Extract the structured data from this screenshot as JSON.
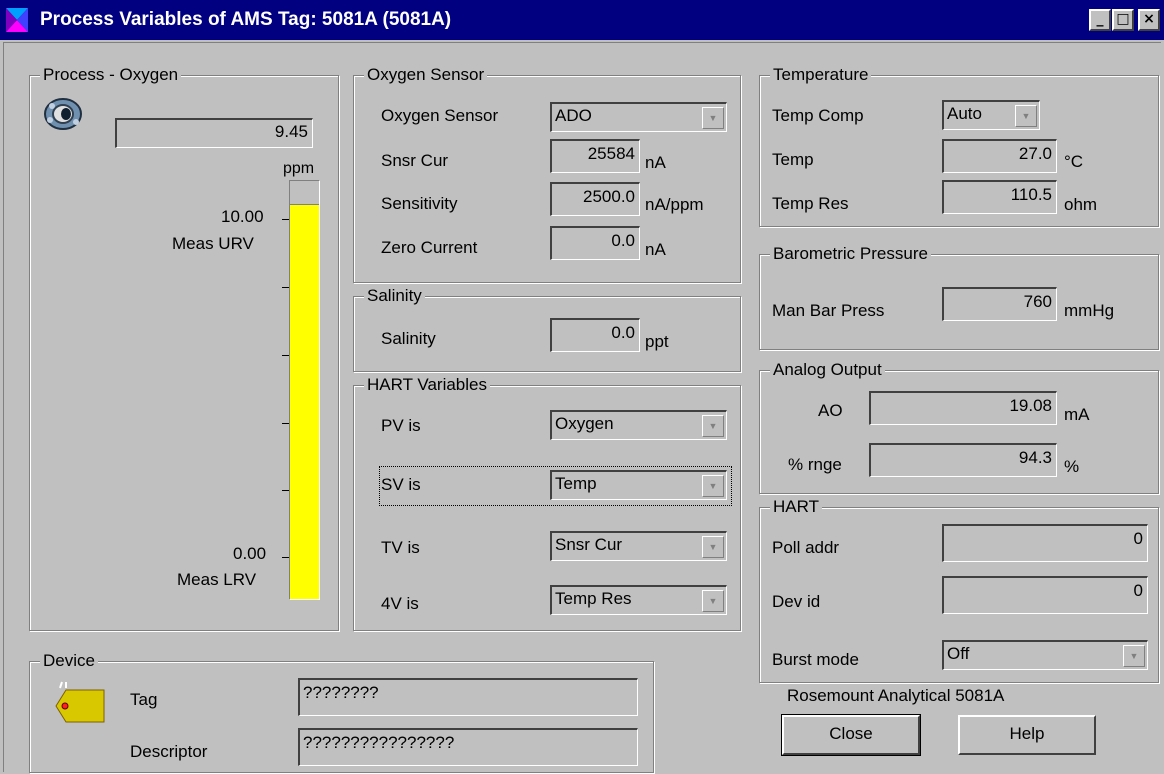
{
  "window": {
    "title": "Process Variables of AMS Tag: 5081A (5081A)",
    "controls": {
      "minimize": "_",
      "maximize": "□",
      "close": "×"
    },
    "colors": {
      "titlebar": "#000080",
      "face": "#c0c0c0",
      "gauge_fill": "#ffff00"
    }
  },
  "process": {
    "legend": "Process - Oxygen",
    "value": "9.45",
    "unit": "ppm",
    "urv_value": "10.00",
    "urv_label": "Meas URV",
    "lrv_value": "0.00",
    "lrv_label": "Meas LRV",
    "fill_fraction": 0.945
  },
  "oxygen_sensor": {
    "legend": "Oxygen Sensor",
    "sensor_label": "Oxygen Sensor",
    "sensor_value": "ADO",
    "snsr_cur_label": "Snsr Cur",
    "snsr_cur_value": "25584",
    "snsr_cur_unit": "nA",
    "sensitivity_label": "Sensitivity",
    "sensitivity_value": "2500.0",
    "sensitivity_unit": "nA/ppm",
    "zero_current_label": "Zero Current",
    "zero_current_value": "0.0",
    "zero_current_unit": "nA"
  },
  "salinity": {
    "legend": "Salinity",
    "label": "Salinity",
    "value": "0.0",
    "unit": "ppt"
  },
  "hart_variables": {
    "legend": "HART Variables",
    "pv_label": "PV is",
    "pv_value": "Oxygen",
    "sv_label": "SV is",
    "sv_value": "Temp",
    "tv_label": "TV is",
    "tv_value": "Snsr Cur",
    "qv_label": "4V is",
    "qv_value": "Temp Res"
  },
  "temperature": {
    "legend": "Temperature",
    "comp_label": "Temp Comp",
    "comp_value": "Auto",
    "temp_label": "Temp",
    "temp_value": "27.0",
    "temp_unit": "°C",
    "res_label": "Temp Res",
    "res_value": "110.5",
    "res_unit": "ohm"
  },
  "barometric": {
    "legend": "Barometric Pressure",
    "label": "Man Bar Press",
    "value": "760",
    "unit": "mmHg"
  },
  "analog_output": {
    "legend": "Analog Output",
    "ao_label": "AO",
    "ao_value": "19.08",
    "ao_unit": "mA",
    "range_label": "% rnge",
    "range_value": "94.3",
    "range_unit": "%"
  },
  "hart": {
    "legend": "HART",
    "poll_label": "Poll addr",
    "poll_value": "0",
    "devid_label": "Dev id",
    "devid_value": "0",
    "burst_label": "Burst mode",
    "burst_value": "Off"
  },
  "device": {
    "legend": "Device",
    "tag_label": "Tag",
    "tag_value": "????????",
    "desc_label": "Descriptor",
    "desc_value": "????????????????"
  },
  "footer": {
    "model": "Rosemount Analytical 5081A",
    "close_label": "Close",
    "help_label": "Help"
  }
}
